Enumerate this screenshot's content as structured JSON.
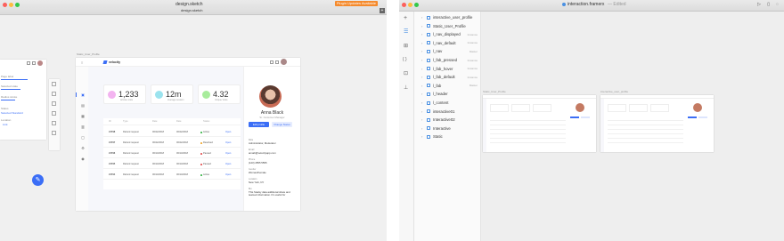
{
  "sketch": {
    "window_title": "design.sketch",
    "tab_title": "design.sketch",
    "plugin_badge": "Plugin Updates Available",
    "artboard_label": "Static_User_Profile",
    "logo_text": "velocity",
    "stats": [
      {
        "value": "1,233",
        "label": "Articles Lists",
        "color": "#f3b3f0"
      },
      {
        "value": "12m",
        "label": "Average session",
        "color": "#9be3ee"
      },
      {
        "value": "4.32",
        "label": "Unique Visits",
        "color": "#a8ec9c"
      }
    ],
    "table_headers": [
      "ID",
      "Type",
      "Date",
      "Date",
      "Status",
      ""
    ],
    "rows": [
      {
        "id": "#4798",
        "type": "Refund request",
        "date1": "06/22/2018",
        "date2": "06/22/2018",
        "status": "Active",
        "action": "Open"
      },
      {
        "id": "#4797",
        "type": "Refund request",
        "date1": "06/22/2018",
        "date2": "06/22/2018",
        "status": "Resolved",
        "action": "Open"
      },
      {
        "id": "#4796",
        "type": "Refund request",
        "date1": "06/13/2018",
        "date2": "06/13/2018",
        "status": "Paused",
        "action": "Open"
      },
      {
        "id": "#4795",
        "type": "Refund request",
        "date1": "06/13/2018",
        "date2": "06/13/2018",
        "status": "Paused",
        "action": "Open"
      },
      {
        "id": "#4794",
        "type": "Refund request",
        "date1": "06/13/2018",
        "date2": "06/13/2018",
        "status": "Active",
        "action": "Open"
      }
    ],
    "profile": {
      "name": "Anna Black",
      "role": "Sr. Customer Manager",
      "edit_label": "Edit profile",
      "change_label": "Change Status",
      "fields": [
        {
          "label": "Role",
          "value": "Administrator, Moderator"
        },
        {
          "label": "Email",
          "value": "annab@velocityapp.com"
        },
        {
          "label": "Phone",
          "value": "(123) 4555 5555"
        },
        {
          "label": "Gender",
          "value": "Woman/Female"
        },
        {
          "label": "Location",
          "value": "New York, NY"
        },
        {
          "label": "Bio",
          "value": "This Stacky data additional share and teamed information. It's useful for"
        }
      ]
    },
    "inspector_labels": [
      "Page label",
      "Selected state",
      "Radius stroke",
      "Status",
      "Selected Standard",
      "Location",
      "Link"
    ]
  },
  "framer": {
    "window_title": "interaction.framerx",
    "edited": "— Edited",
    "layers": [
      {
        "name": "interactive_user_profile",
        "type": ""
      },
      {
        "name": "Static_User_Profile",
        "type": ""
      },
      {
        "name": "l_nav_displayed",
        "type": "Instance"
      },
      {
        "name": "l_nav_default",
        "type": "Instance"
      },
      {
        "name": "l_nav",
        "type": "Master"
      },
      {
        "name": "l_fab_pressed",
        "type": "Instance"
      },
      {
        "name": "l_fab_hover",
        "type": "Instance"
      },
      {
        "name": "l_fab_default",
        "type": "Instance"
      },
      {
        "name": "l_fab",
        "type": "Master"
      },
      {
        "name": "l_header",
        "type": ""
      },
      {
        "name": "l_content",
        "type": ""
      },
      {
        "name": "interactive01",
        "type": ""
      },
      {
        "name": "Interactive02",
        "type": ""
      },
      {
        "name": "Interactive",
        "type": ""
      },
      {
        "name": "Static",
        "type": ""
      }
    ],
    "thumb_labels": [
      "Static_User_Profile",
      "interactive_user_profile"
    ]
  }
}
